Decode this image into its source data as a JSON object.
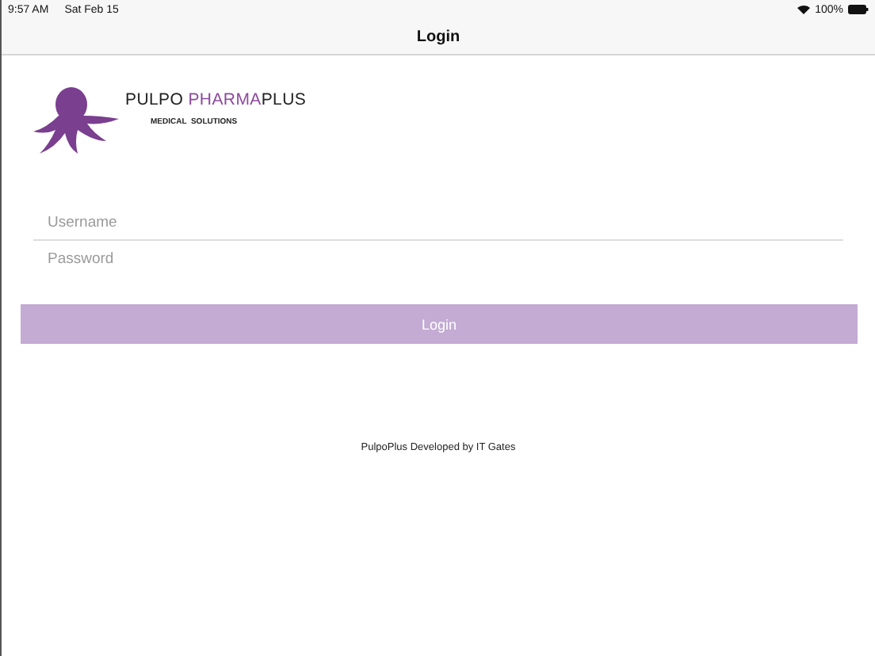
{
  "status_bar": {
    "time": "9:57 AM",
    "date": "Sat Feb 15",
    "battery": "100%"
  },
  "nav_bar": {
    "title": "Login"
  },
  "logo": {
    "parts": [
      {
        "text": "PULPO ",
        "accent": false
      },
      {
        "text": "PHARMA",
        "accent": true
      },
      {
        "text": "PLUS",
        "accent": false
      }
    ],
    "tagline": "MEDICAL  SOLUTIONS"
  },
  "form": {
    "username": {
      "placeholder": "Username"
    },
    "password": {
      "placeholder": "Password"
    },
    "login_button": {
      "label": "Login",
      "disabled": true
    }
  },
  "footer": "PulpoPlus Developed by IT Gates"
}
